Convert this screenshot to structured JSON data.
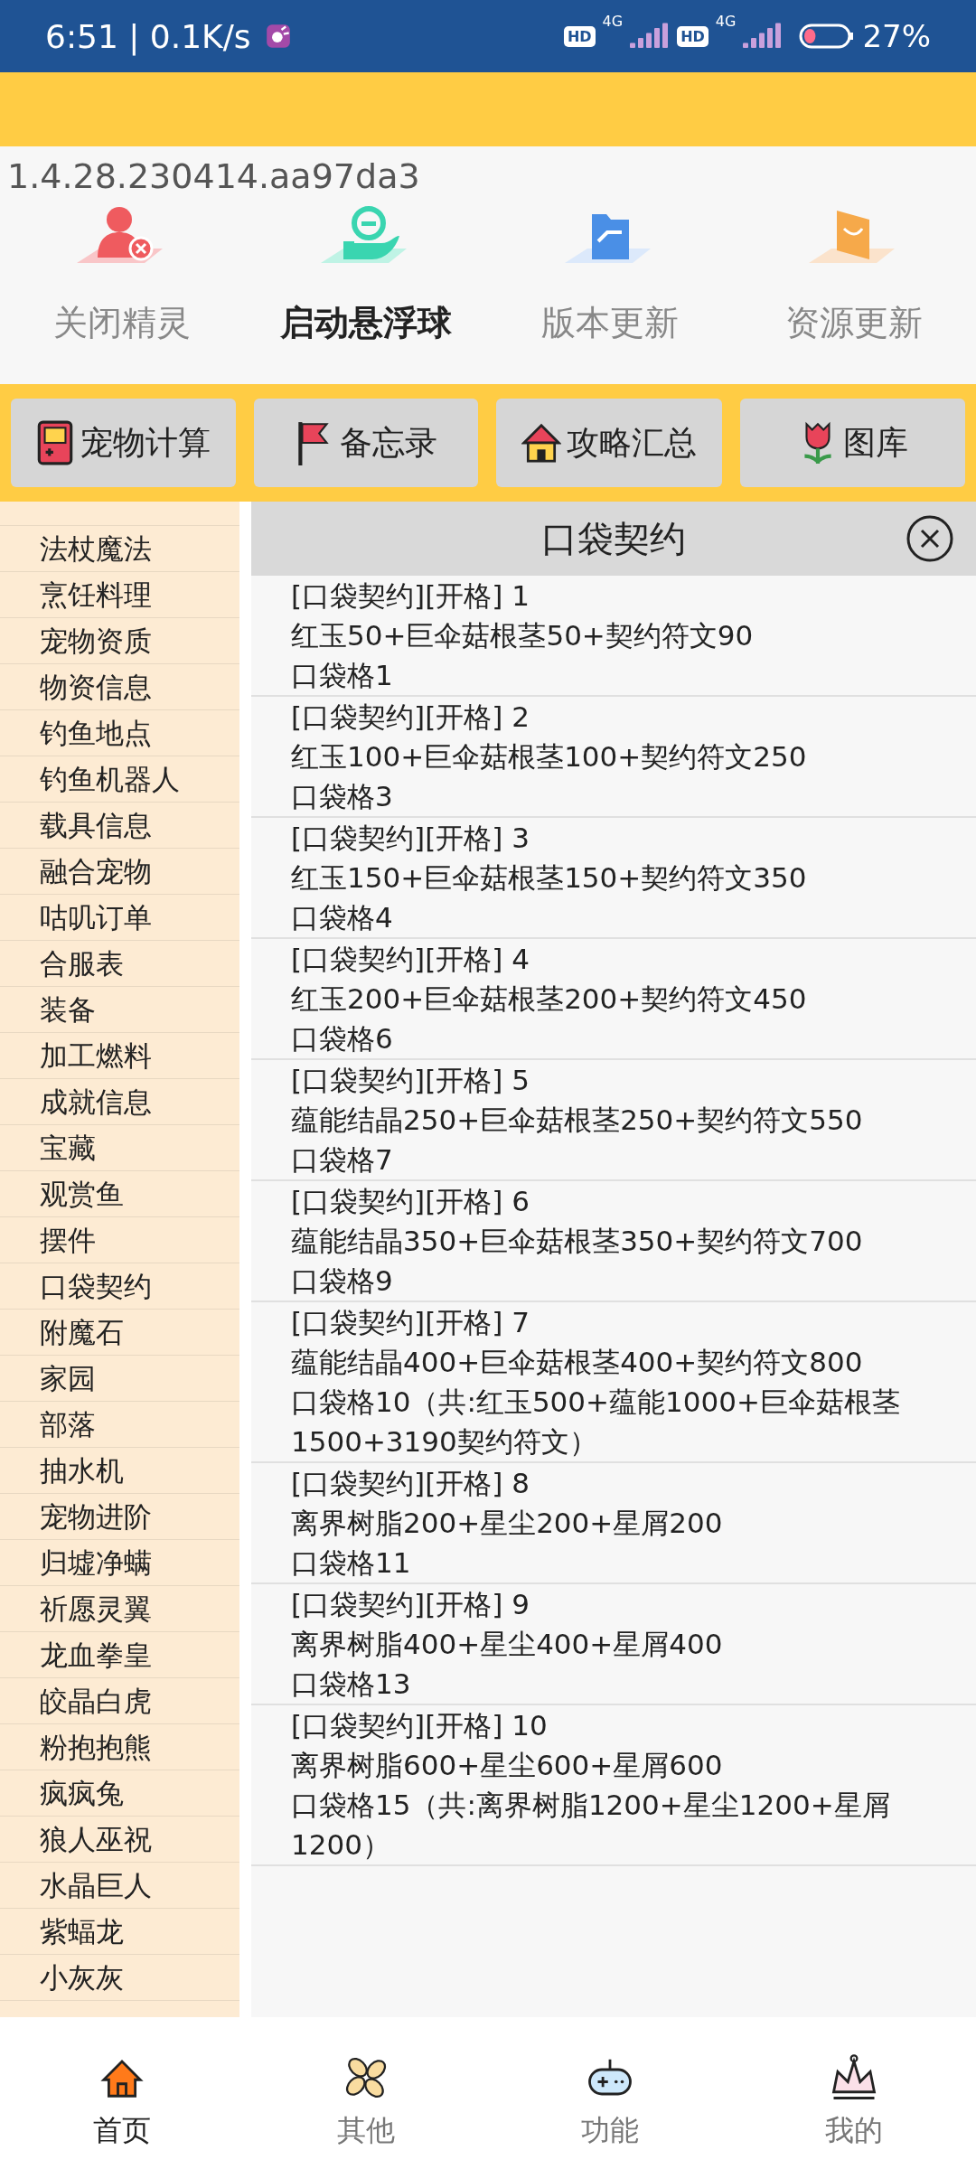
{
  "status_bar": {
    "time": "6:51 | 0.1K/s",
    "sims": [
      {
        "hd": "HD",
        "net": "4G"
      },
      {
        "hd": "HD",
        "net": "4G"
      }
    ],
    "battery": {
      "level": 0.27,
      "text": "27%"
    }
  },
  "version": "1.4.28.230414.aa97da3",
  "actions": [
    {
      "label": "关闭精灵",
      "kind": "person",
      "selected": false
    },
    {
      "label": "启动悬浮球",
      "kind": "hand",
      "selected": true
    },
    {
      "label": "版本更新",
      "kind": "folder",
      "selected": false
    },
    {
      "label": "资源更新",
      "kind": "box",
      "selected": false
    }
  ],
  "toolbar": [
    {
      "label": "宠物计算",
      "kind": "gameboy"
    },
    {
      "label": "备忘录",
      "kind": "flag"
    },
    {
      "label": "攻略汇总",
      "kind": "house"
    },
    {
      "label": "图库",
      "kind": "flower"
    }
  ],
  "sidebar": {
    "items": [
      {
        "label": "法杖魔法",
        "selected": false
      },
      {
        "label": "烹饪料理",
        "selected": false
      },
      {
        "label": "宠物资质",
        "selected": false
      },
      {
        "label": "物资信息",
        "selected": false
      },
      {
        "label": "钓鱼地点",
        "selected": false
      },
      {
        "label": "钓鱼机器人",
        "selected": false
      },
      {
        "label": "载具信息",
        "selected": false
      },
      {
        "label": "融合宠物",
        "selected": false
      },
      {
        "label": "咕叽订单",
        "selected": false
      },
      {
        "label": "合服表",
        "selected": false
      },
      {
        "label": "装备",
        "selected": false
      },
      {
        "label": "加工燃料",
        "selected": false
      },
      {
        "label": "成就信息",
        "selected": false
      },
      {
        "label": "宝藏",
        "selected": false
      },
      {
        "label": "观赏鱼",
        "selected": false
      },
      {
        "label": "摆件",
        "selected": false
      },
      {
        "label": "口袋契约",
        "selected": false
      },
      {
        "label": "附魔石",
        "selected": false
      },
      {
        "label": "家园",
        "selected": false
      },
      {
        "label": "部落",
        "selected": false
      },
      {
        "label": "抽水机",
        "selected": false
      },
      {
        "label": "宠物进阶",
        "selected": false
      },
      {
        "label": "归墟净螨",
        "selected": false
      },
      {
        "label": "祈愿灵翼",
        "selected": false
      },
      {
        "label": "龙血拳皇",
        "selected": false
      },
      {
        "label": "皎晶白虎",
        "selected": false
      },
      {
        "label": "粉抱抱熊",
        "selected": false
      },
      {
        "label": "疯疯兔",
        "selected": false
      },
      {
        "label": "狼人巫祝",
        "selected": false
      },
      {
        "label": "水晶巨人",
        "selected": false
      },
      {
        "label": "紫蝠龙",
        "selected": false
      },
      {
        "label": "小灰灰",
        "selected": false
      }
    ]
  },
  "panel": {
    "title": "口袋契约",
    "entries": [
      {
        "title": "[口袋契约][开格] 1",
        "cost": "红玉50+巨伞菇根茎50+契约符文90",
        "result": "口袋格1"
      },
      {
        "title": "[口袋契约][开格] 2",
        "cost": "红玉100+巨伞菇根茎100+契约符文250",
        "result": "口袋格3"
      },
      {
        "title": "[口袋契约][开格] 3",
        "cost": "红玉150+巨伞菇根茎150+契约符文350",
        "result": "口袋格4"
      },
      {
        "title": "[口袋契约][开格] 4",
        "cost": "红玉200+巨伞菇根茎200+契约符文450",
        "result": "口袋格6"
      },
      {
        "title": "[口袋契约][开格] 5",
        "cost": "蕴能结晶250+巨伞菇根茎250+契约符文550",
        "result": "口袋格7"
      },
      {
        "title": "[口袋契约][开格] 6",
        "cost": "蕴能结晶350+巨伞菇根茎350+契约符文700",
        "result": "口袋格9"
      },
      {
        "title": "[口袋契约][开格] 7",
        "cost": "蕴能结晶400+巨伞菇根茎400+契约符文800",
        "result": "口袋格10（共:红玉500+蕴能1000+巨伞菇根茎1500+3190契约符文）"
      },
      {
        "title": "[口袋契约][开格] 8",
        "cost": "离界树脂200+星尘200+星屑200",
        "result": "口袋格11"
      },
      {
        "title": "[口袋契约][开格] 9",
        "cost": "离界树脂400+星尘400+星屑400",
        "result": "口袋格13"
      },
      {
        "title": "[口袋契约][开格] 10",
        "cost": "离界树脂600+星尘600+星屑600",
        "result": "口袋格15（共:离界树脂1200+星尘1200+星屑1200）"
      }
    ]
  },
  "bottom_nav": [
    {
      "label": "首页",
      "kind": "home",
      "selected": true
    },
    {
      "label": "其他",
      "kind": "pinwheel",
      "selected": false
    },
    {
      "label": "功能",
      "kind": "gamepad",
      "selected": false
    },
    {
      "label": "我的",
      "kind": "crown",
      "selected": false
    }
  ]
}
